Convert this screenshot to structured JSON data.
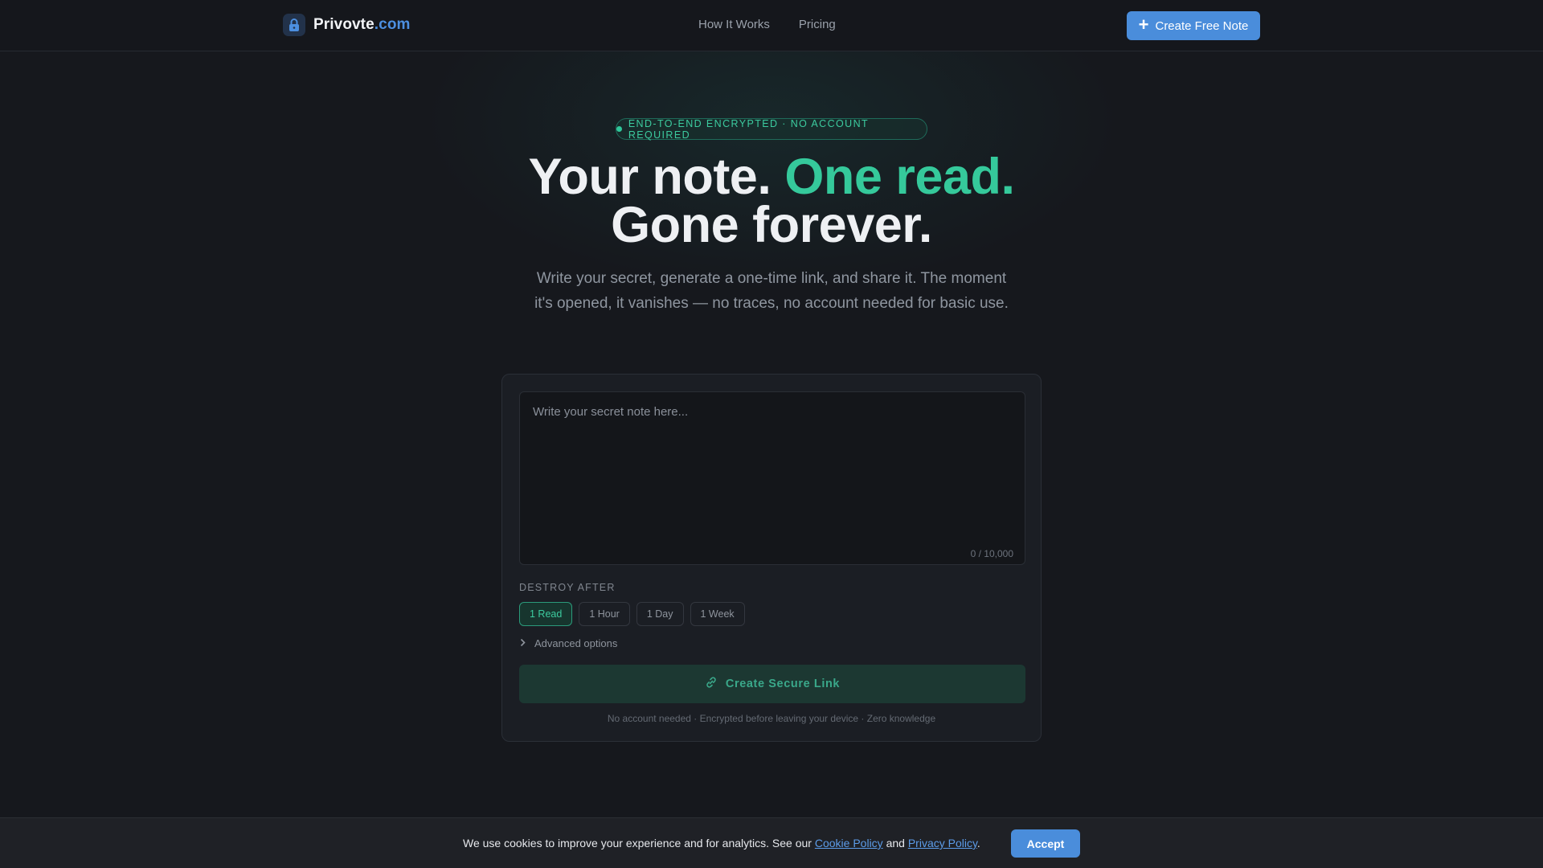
{
  "header": {
    "brand_name": "Privovte",
    "brand_tld": ".com",
    "nav": [
      {
        "label": "How It Works"
      },
      {
        "label": "Pricing"
      }
    ],
    "cta_label": "Create Free Note"
  },
  "hero": {
    "badge": "END-TO-END ENCRYPTED · NO ACCOUNT REQUIRED",
    "headline_part1": "Your note. ",
    "headline_accent": "One read.",
    "headline_line2": "Gone forever.",
    "subtext": "Write your secret, generate a one-time link, and share it. The moment it's opened, it vanishes — no traces, no account needed for basic use."
  },
  "card": {
    "note_placeholder": "Write your secret note here...",
    "note_value": "",
    "char_counter": "0 / 10,000",
    "destroy_label": "DESTROY AFTER",
    "destroy_options": [
      {
        "label": "1 Read",
        "selected": true
      },
      {
        "label": "1 Hour",
        "selected": false
      },
      {
        "label": "1 Day",
        "selected": false
      },
      {
        "label": "1 Week",
        "selected": false
      }
    ],
    "advanced_label": "Advanced options",
    "create_label": "Create Secure Link",
    "footnote": "No account needed · Encrypted before leaving your device · Zero knowledge"
  },
  "cookie": {
    "text_before": "We use cookies to improve your experience and for analytics. See our ",
    "cookie_policy": "Cookie Policy",
    "text_and": " and ",
    "privacy_policy": "Privacy Policy",
    "text_end": ".",
    "accept_label": "Accept"
  },
  "colors": {
    "accent_green": "#35c99b",
    "accent_blue": "#4a8ddb",
    "background": "#16181d"
  },
  "icons": [
    "lock-icon",
    "plus-icon",
    "chevron-right-icon",
    "link-icon"
  ]
}
